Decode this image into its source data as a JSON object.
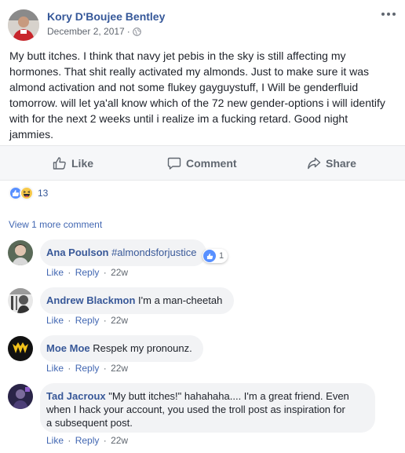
{
  "post": {
    "author": "Kory D'Boujee Bentley",
    "date": "December 2, 2017",
    "separator": "·",
    "text": "My butt itches. I think that navy jet pebis in the sky is still affecting my hormones. That shit really activated my almonds. Just to make sure it was almond activation and not some flukey gayguystuff, I Will be genderfluid tomorrow. will let ya'all know which of the 72 new gender-options i will identify with for the next 2 weeks until i realize im a fucking retard. Good night jammies."
  },
  "actions": {
    "like": "Like",
    "comment": "Comment",
    "share": "Share"
  },
  "reactions": {
    "count": "13",
    "types": [
      "like",
      "haha"
    ]
  },
  "view_more": "View 1 more comment",
  "comment_actions": {
    "like": "Like",
    "reply": "Reply",
    "dot": "·"
  },
  "comments": [
    {
      "author": "Ana Poulson",
      "text": "#almondsforjustice",
      "time": "22w",
      "reaction_count": "1"
    },
    {
      "author": "Andrew Blackmon",
      "text": "I'm a man-cheetah",
      "time": "22w"
    },
    {
      "author": "Moe Moe",
      "text": "Respek my pronounz.",
      "time": "22w"
    },
    {
      "author": "Tad Jacroux",
      "text_line1": "\"My butt itches!\" hahahaha.... I'm a great friend. Even",
      "text_line2": "when I hack your account, you used the troll post as inspiration for",
      "text_line3": "a subsequent post.",
      "time": "22w"
    }
  ],
  "colors": {
    "link": "#365899",
    "action_gray": "#606770",
    "bubble": "#f2f3f5",
    "like_blue": "#5890ff",
    "haha_yellow": "#f7c949"
  }
}
